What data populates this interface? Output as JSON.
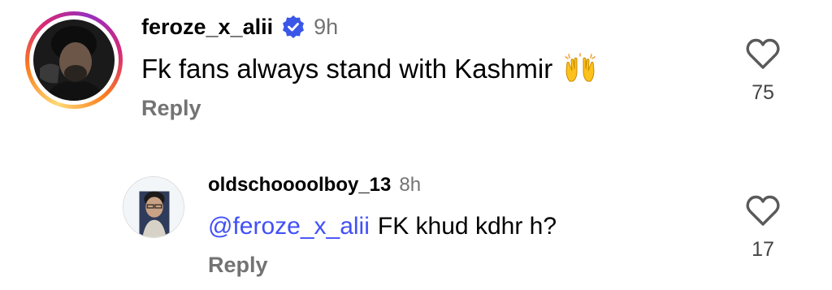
{
  "comments": [
    {
      "username": "feroze_x_alii",
      "verified": true,
      "timestamp": "9h",
      "text": "Fk fans always stand with Kashmir",
      "emoji": "raising-hands",
      "reply_label": "Reply",
      "likes": "75",
      "avatar_story_ring": true
    },
    {
      "username": "oldschoooolboy_13",
      "timestamp": "8h",
      "mention": "@feroze_x_alii",
      "text": "FK khud kdhr h?",
      "reply_label": "Reply",
      "likes": "17"
    }
  ],
  "colors": {
    "mention": "#4150f7",
    "verified_badge": "#3a57e8",
    "secondary_text": "#737373"
  }
}
